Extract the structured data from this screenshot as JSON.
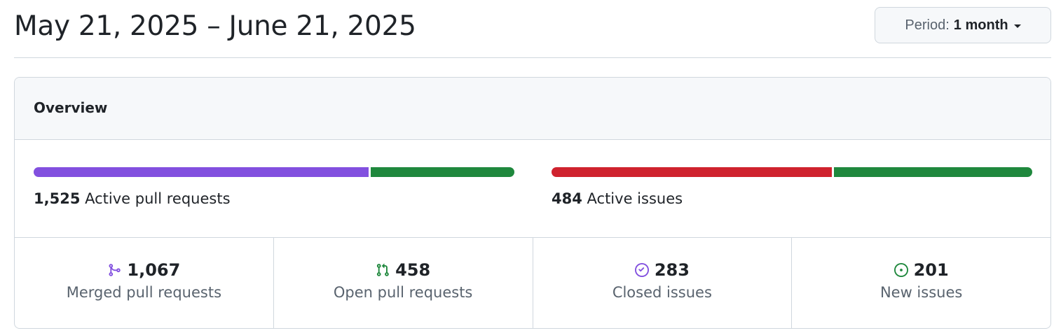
{
  "header": {
    "title": "May 21, 2025 – June 21, 2025",
    "period_prefix": "Period:",
    "period_value": "1 month"
  },
  "overview": {
    "title": "Overview",
    "pull_requests": {
      "count": "1,525",
      "label": "Active pull requests",
      "merged_fraction": 0.7,
      "colors": {
        "merged": "#8250df",
        "open": "#1f883d"
      }
    },
    "issues": {
      "count": "484",
      "label": "Active issues",
      "closed_fraction": 0.585,
      "colors": {
        "closed": "#cf222e",
        "new": "#1f883d"
      }
    },
    "stats": [
      {
        "icon": "git-merge-icon",
        "color": "#8250df",
        "value": "1,067",
        "label": "Merged pull requests"
      },
      {
        "icon": "git-pull-request-icon",
        "color": "#1f883d",
        "value": "458",
        "label": "Open pull requests"
      },
      {
        "icon": "issue-closed-icon",
        "color": "#8250df",
        "value": "283",
        "label": "Closed issues"
      },
      {
        "icon": "issue-opened-icon",
        "color": "#1f883d",
        "value": "201",
        "label": "New issues"
      }
    ]
  }
}
